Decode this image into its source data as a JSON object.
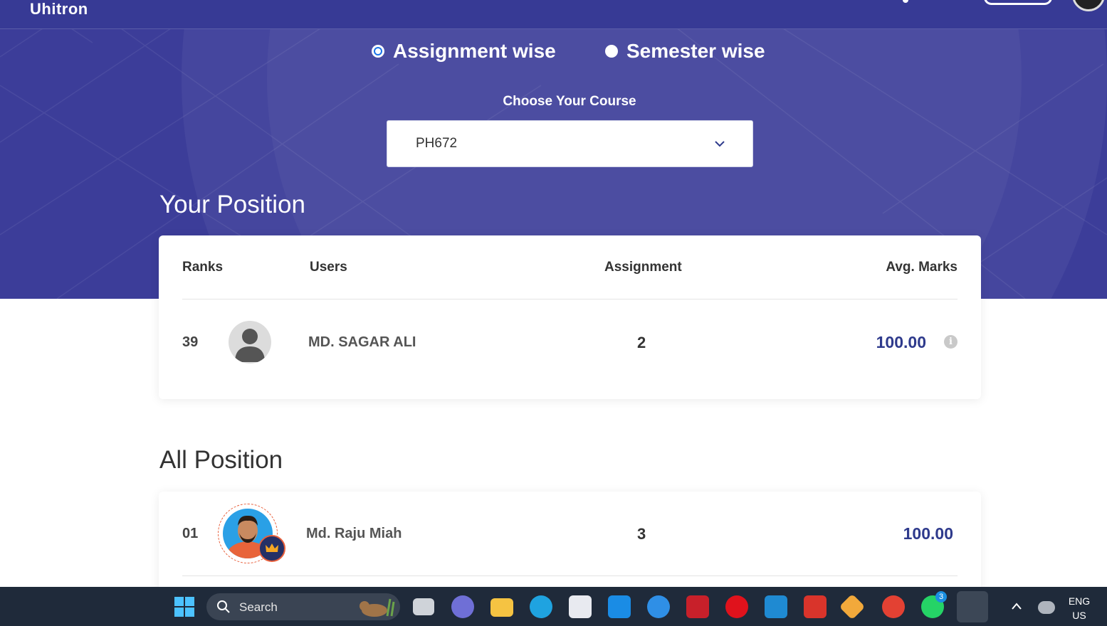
{
  "header": {
    "logo": "Uhitron"
  },
  "filters": {
    "assignment_label": "Assignment wise",
    "semester_label": "Semester wise",
    "selected": "assignment"
  },
  "course": {
    "label": "Choose Your Course",
    "selected": "PH672"
  },
  "your_position": {
    "title": "Your Position",
    "columns": {
      "ranks": "Ranks",
      "users": "Users",
      "assignment": "Assignment",
      "avg_marks": "Avg. Marks"
    },
    "row": {
      "rank": "39",
      "name": "MD. SAGAR ALI",
      "assignment": "2",
      "avg_marks": "100.00"
    }
  },
  "all_position": {
    "title": "All Position",
    "rows": [
      {
        "rank": "01",
        "name": "Md. Raju Miah",
        "assignment": "3",
        "avg_marks": "100.00"
      }
    ]
  },
  "taskbar": {
    "search_label": "Search",
    "language": "ENG",
    "region": "US",
    "whatsapp_badge": "3"
  },
  "colors": {
    "hero": "#3c3d99",
    "accent": "#2e3a8c",
    "taskbar": "#1f2a3a"
  }
}
